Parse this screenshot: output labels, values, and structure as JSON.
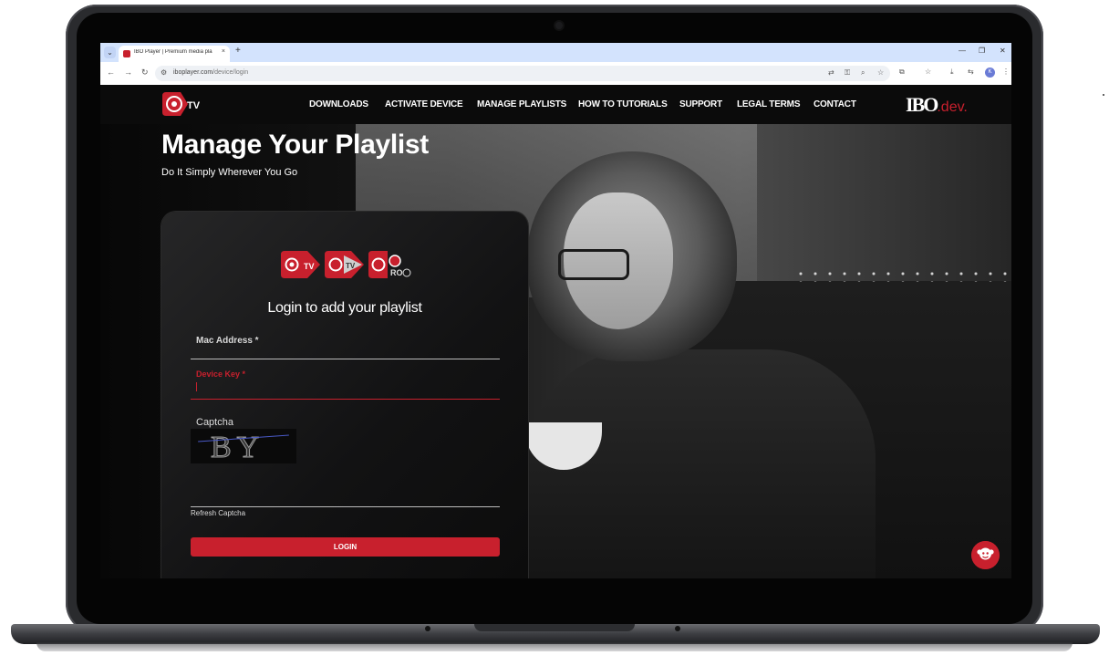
{
  "browser": {
    "tab_title": "IBO Player | Premium media pla",
    "tab_close": "×",
    "new_tab": "+",
    "url_domain": "iboplayer.com",
    "url_path": "/device/login",
    "profile_initial": "K",
    "window_minimize": "—",
    "window_restore": "❐",
    "window_close": "✕"
  },
  "nav": {
    "brand_text": "TV",
    "menu": [
      {
        "label": "DOWNLOADS"
      },
      {
        "label": "ACTIVATE DEVICE"
      },
      {
        "label": "MANAGE PLAYLISTS"
      },
      {
        "label": "HOW TO TUTORIALS"
      },
      {
        "label": "SUPPORT"
      },
      {
        "label": "LEGAL TERMS"
      },
      {
        "label": "CONTACT"
      }
    ],
    "partner_logo": "IBO",
    "partner_logo_suffix": ".dev."
  },
  "hero": {
    "title": "Manage Your Playlist",
    "subtitle": "Do It Simply Wherever You Go"
  },
  "login": {
    "heading": "Login to add your playlist",
    "mac_label": "Mac Address *",
    "device_key_label": "Device Key *",
    "captcha_label": "Captcha",
    "captcha_text": "BY",
    "refresh_label": "Refresh Captcha",
    "button_label": "LOGIN"
  },
  "colors": {
    "brand_red": "#c8202d",
    "tab_bar": "#d3e3fd"
  }
}
